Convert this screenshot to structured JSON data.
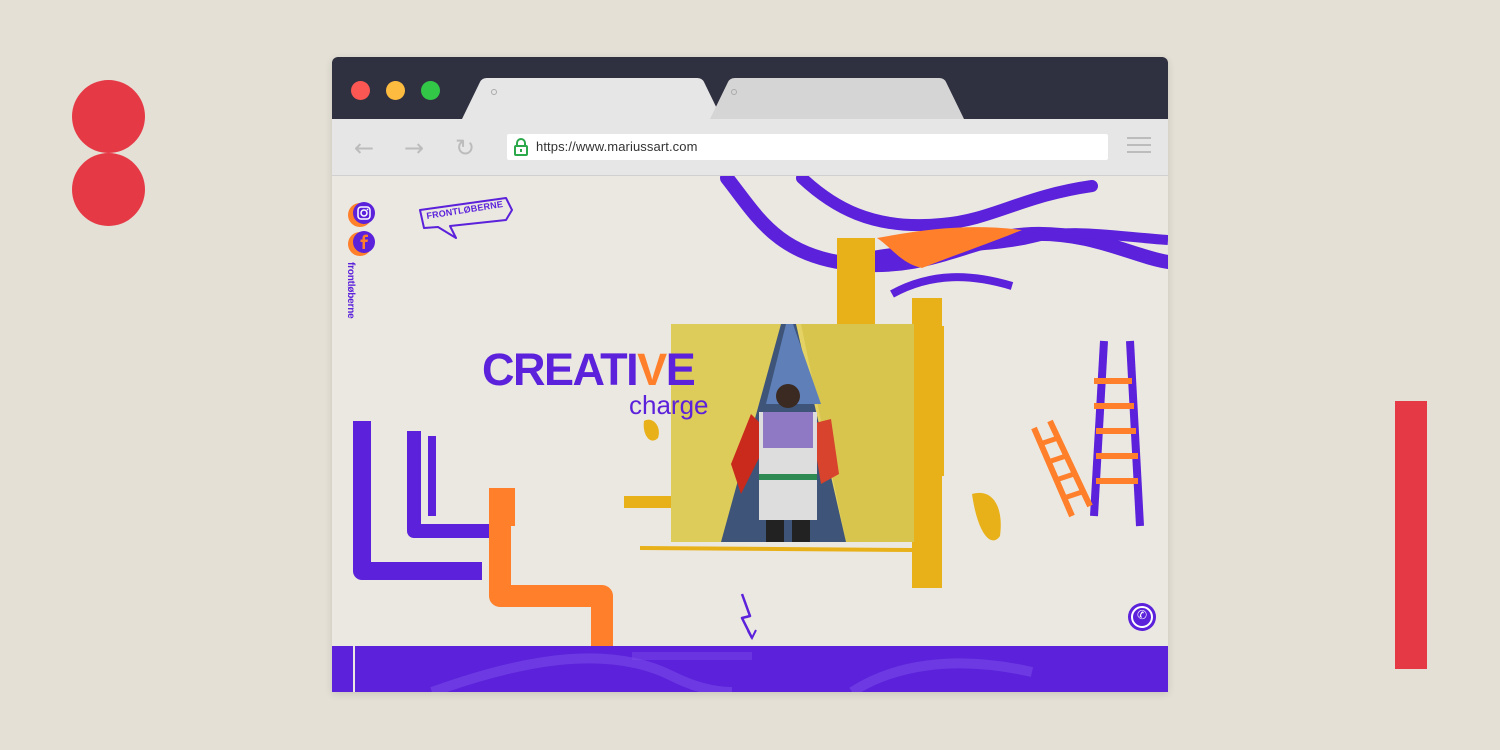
{
  "browser": {
    "url": "https://www.mariussart.com",
    "back_icon": "←",
    "forward_icon": "→",
    "reload_icon": "↻"
  },
  "site": {
    "logo_text": "FRONTLØBERNE",
    "vertical_brand": "frontløberne",
    "headline_main": "CREATI",
    "headline_accent": "V",
    "headline_end": "E",
    "subheadline": "charge",
    "phone_glyph": "✆"
  },
  "colors": {
    "purple": "#5b21db",
    "orange": "#ff7f2a",
    "yellow": "#e8b11a",
    "red_accent": "#e63946",
    "background": "#e4e0d5"
  },
  "icons": [
    "instagram-icon",
    "facebook-icon",
    "lock-icon",
    "hamburger-menu-icon",
    "phone-icon",
    "lightning-icon"
  ]
}
